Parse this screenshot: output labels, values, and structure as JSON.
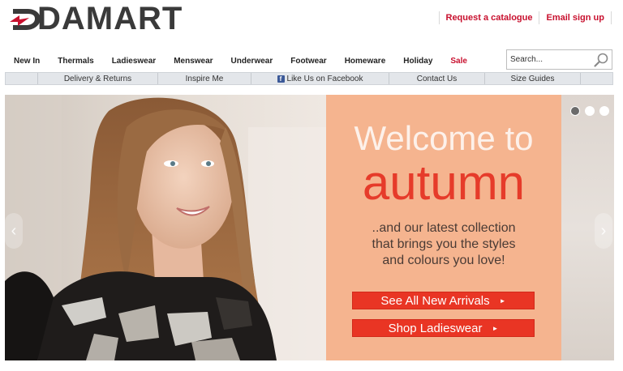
{
  "brand": {
    "name": "DAMART",
    "accent": "#c8102e"
  },
  "top_links": [
    "Request a catalogue",
    "Email sign up"
  ],
  "nav": {
    "items": [
      "New In",
      "Thermals",
      "Ladieswear",
      "Menswear",
      "Underwear",
      "Footwear",
      "Homeware",
      "Holiday",
      "Sale"
    ]
  },
  "search": {
    "placeholder": "Search...",
    "icon": "magnifier-icon"
  },
  "subnav": {
    "items": [
      "Delivery & Returns",
      "Inspire Me",
      "Like Us on Facebook",
      "Contact Us",
      "Size Guides"
    ]
  },
  "hero": {
    "headline": "Welcome to",
    "season": "autumn",
    "tagline_lines": [
      "..and our latest collection",
      "that brings you the styles",
      "and colours you love!"
    ],
    "cta_primary": "See All New Arrivals",
    "cta_secondary": "Shop Ladieswear",
    "arrow": "►",
    "prev_arrow": "‹",
    "next_arrow": "›",
    "panel_color": "#f5b48f",
    "button_color": "#e93524"
  }
}
